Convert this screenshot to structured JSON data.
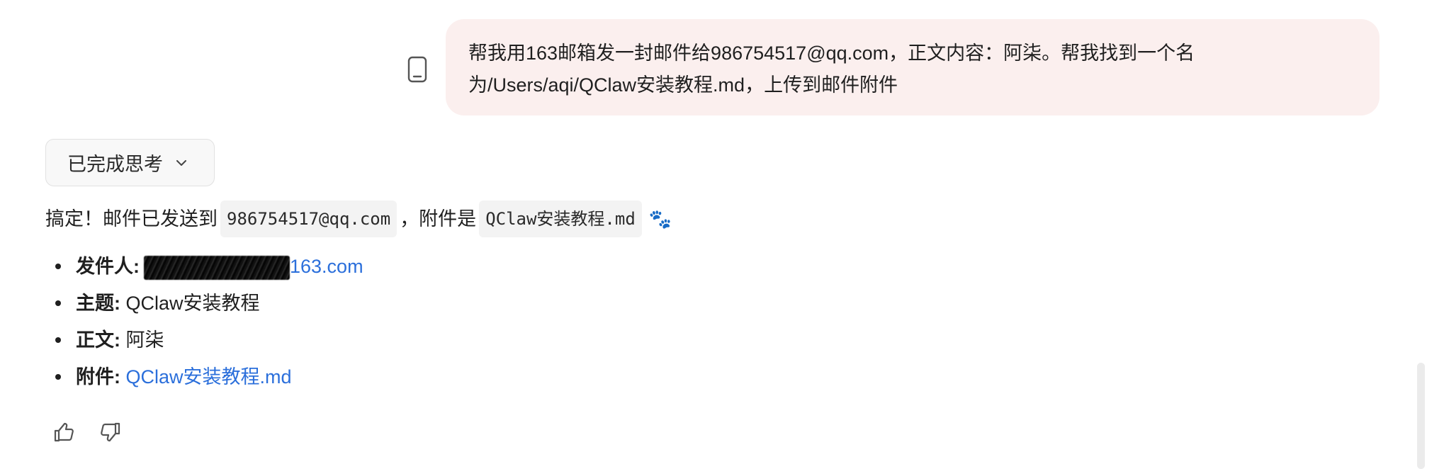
{
  "user_message": {
    "lines": [
      "帮我用163邮箱发一封邮件给986754517@qq.com，正文内容：阿柒。帮我找到一个名",
      "为/Users/aqi/QClaw安装教程.md，上传到邮件附件"
    ],
    "device_icon": "mobile-phone-icon"
  },
  "thinking": {
    "label": "已完成思考",
    "icon": "chevron-down-icon"
  },
  "reply": {
    "prefix": "搞定！邮件已发送到",
    "recipient": "986754517@qq.com",
    "middle": "，附件是",
    "attachment_code": "QClaw安装教程.md",
    "emoji": "🐾",
    "details": [
      {
        "label": "发件人:",
        "value": "163.com",
        "redacted": true
      },
      {
        "label": "主题:",
        "value": "QClaw安装教程"
      },
      {
        "label": "正文:",
        "value": "阿柒"
      },
      {
        "label": "附件:",
        "value": "QClaw安装教程.md"
      }
    ]
  },
  "feedback": {
    "like_icon": "thumbs-up-icon",
    "dislike_icon": "thumbs-down-icon"
  }
}
